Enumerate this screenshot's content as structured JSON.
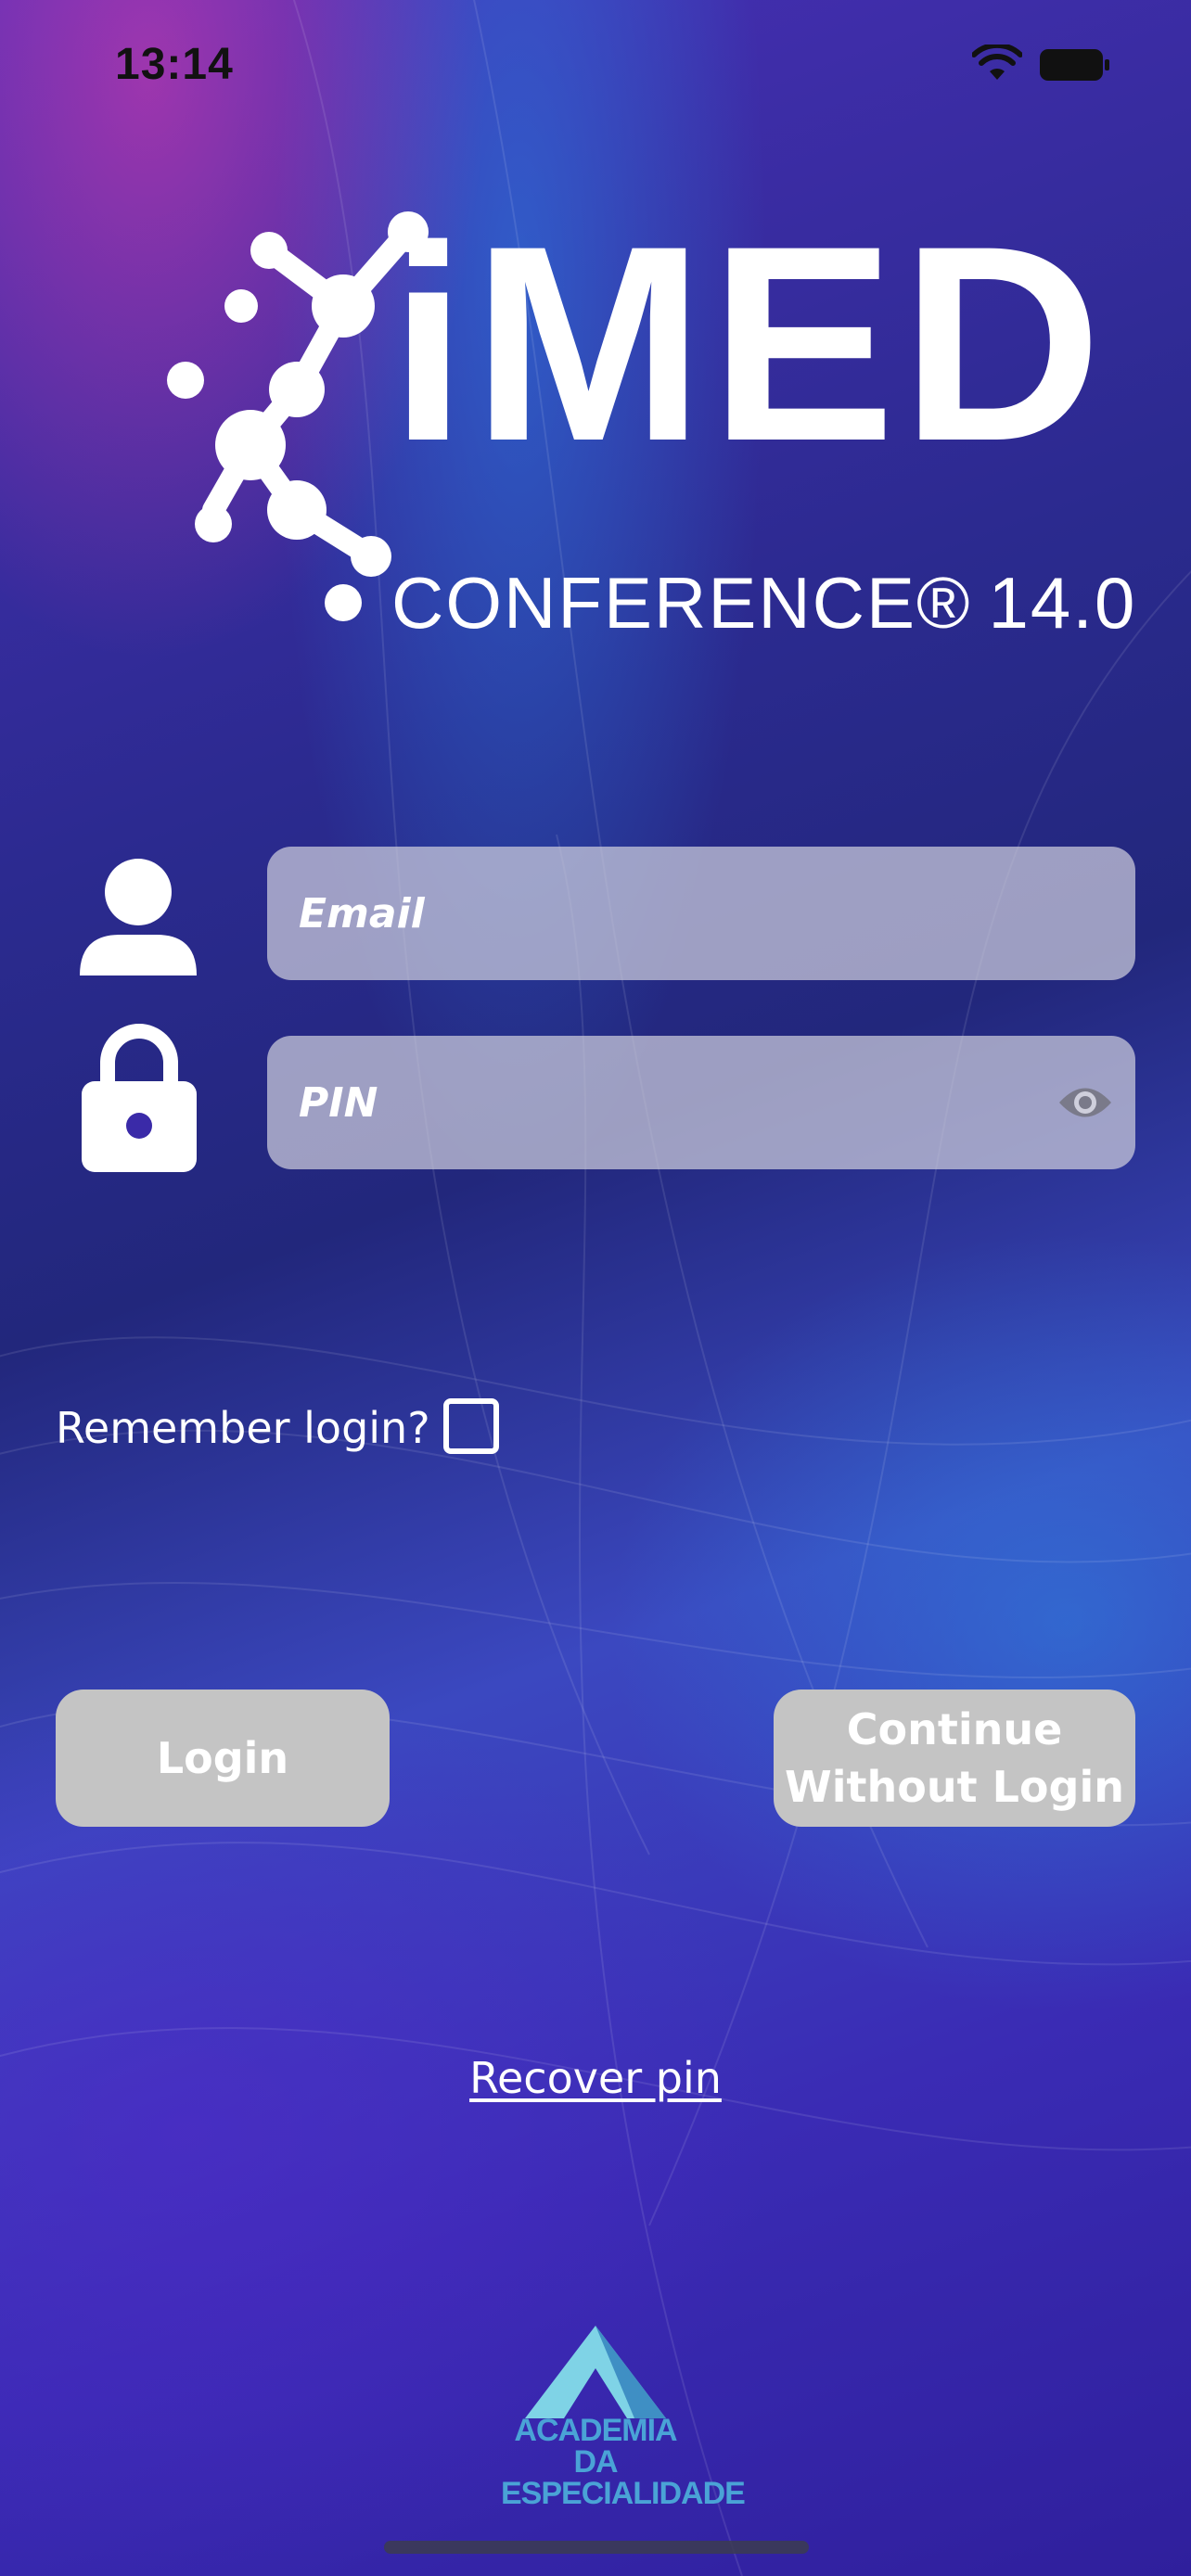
{
  "status_bar": {
    "time": "13:14"
  },
  "brand": {
    "wordmark": "iMED",
    "subtitle": "CONFERENCE®",
    "edition": "14.0"
  },
  "login_form": {
    "email_placeholder": "Email",
    "pin_placeholder": "PIN",
    "remember_label": "Remember login?",
    "remember_checked": false
  },
  "buttons": {
    "login_label": "Login",
    "continue_label": "Continue Without Login"
  },
  "links": {
    "recover_pin": "Recover pin"
  },
  "footer": {
    "sponsor_line1": "ACADEMIA DA",
    "sponsor_line2": "ESPECIALIDADE"
  },
  "icons": [
    "wifi-icon",
    "battery-icon",
    "person-icon",
    "lock-icon",
    "eye-icon"
  ],
  "colors": {
    "field_bg": "#cdcddc",
    "button_bg": "#c4c4c4",
    "sponsor_accent": "#4aa3d6"
  }
}
